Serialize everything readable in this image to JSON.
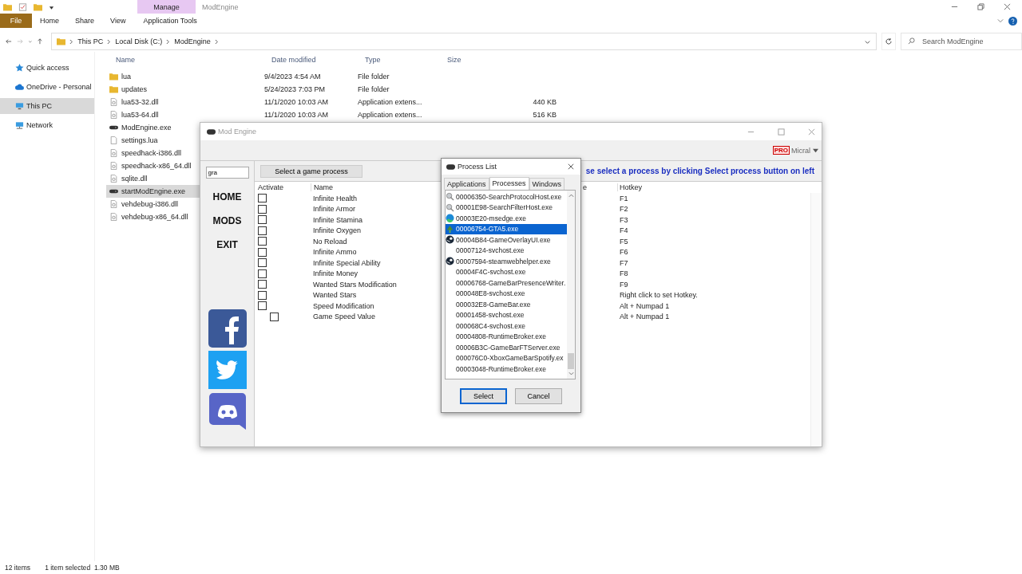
{
  "explorer": {
    "title": "ModEngine",
    "context_group": "Manage",
    "ribbon_tabs": [
      {
        "label": "File",
        "kind": "file"
      },
      {
        "label": "Home",
        "kind": "tab"
      },
      {
        "label": "Share",
        "kind": "tab"
      },
      {
        "label": "View",
        "kind": "tab"
      },
      {
        "label": "Application Tools",
        "kind": "context"
      }
    ],
    "breadcrumb": [
      "This PC",
      "Local Disk (C:)",
      "ModEngine"
    ],
    "search": {
      "placeholder": "Search ModEngine"
    },
    "nav": [
      {
        "label": "Quick access",
        "kind": "star",
        "selected": false
      },
      {
        "label": "OneDrive - Personal",
        "kind": "cloud",
        "selected": false
      },
      {
        "label": "This PC",
        "kind": "pc",
        "selected": true
      },
      {
        "label": "Network",
        "kind": "network",
        "selected": false
      }
    ],
    "columns": [
      "Name",
      "Date modified",
      "Type",
      "Size"
    ],
    "files": [
      {
        "name": "lua",
        "kind": "folder",
        "date": "9/4/2023 4:54 AM",
        "type": "File folder",
        "selected": false
      },
      {
        "name": "updates",
        "kind": "folder",
        "date": "5/24/2023 7:03 PM",
        "type": "File folder",
        "selected": false
      },
      {
        "name": "lua53-32.dll",
        "kind": "dll",
        "date": "11/1/2020 10:03 AM",
        "type": "Application extens...",
        "size": "440 KB",
        "selected": false
      },
      {
        "name": "lua53-64.dll",
        "kind": "dll",
        "date": "11/1/2020 10:03 AM",
        "type": "Application extens...",
        "size": "516 KB",
        "selected": false
      },
      {
        "name": "ModEngine.exe",
        "kind": "exe",
        "selected": false
      },
      {
        "name": "settings.lua",
        "kind": "file",
        "selected": false
      },
      {
        "name": "speedhack-i386.dll",
        "kind": "dll",
        "selected": false
      },
      {
        "name": "speedhack-x86_64.dll",
        "kind": "dll",
        "selected": false
      },
      {
        "name": "sqlite.dll",
        "kind": "dll",
        "selected": false
      },
      {
        "name": "startModEngine.exe",
        "kind": "exe",
        "selected": true
      },
      {
        "name": "vehdebug-i386.dll",
        "kind": "dll",
        "selected": false
      },
      {
        "name": "vehdebug-x86_64.dll",
        "kind": "dll",
        "selected": false
      }
    ],
    "status": {
      "count": "12 items",
      "selection": "1 item selected  1.30 MB"
    }
  },
  "mod_engine": {
    "title": "Mod Engine",
    "badge": "PRO",
    "account": "Micral",
    "search_value": "gra",
    "nav": [
      "HOME",
      "MODS",
      "EXIT"
    ],
    "select_button": "Select a game process",
    "message": "se select a process by clicking Select process button on left",
    "columns": [
      "Activate",
      "Name",
      "e",
      "Hotkey"
    ],
    "mods": [
      {
        "name": "Infinite Health",
        "hotkey": "F1",
        "checked": false
      },
      {
        "name": "Infinite Armor",
        "hotkey": "F2",
        "checked": false
      },
      {
        "name": "Infinite Stamina",
        "hotkey": "F3",
        "checked": false
      },
      {
        "name": "Infinite Oxygen",
        "hotkey": "F4",
        "checked": false
      },
      {
        "name": "No Reload",
        "hotkey": "F5",
        "checked": false
      },
      {
        "name": "Infinite Ammo",
        "hotkey": "F6",
        "checked": false
      },
      {
        "name": "Infinite Special Ability",
        "hotkey": "F7",
        "checked": false
      },
      {
        "name": "Infinite Money",
        "hotkey": "F8",
        "checked": false
      },
      {
        "name": "Wanted Stars Modification",
        "hotkey": "F9",
        "checked": false
      },
      {
        "name": "Wanted Stars",
        "hotkey": "Right click to set Hotkey.",
        "checked": false
      },
      {
        "name": "Speed Modification",
        "hotkey": "Alt + Numpad 1",
        "checked": false,
        "children": [
          {
            "name": "Game Speed Value",
            "hotkey": "Alt + Numpad 1",
            "checked": false
          }
        ]
      }
    ],
    "social": [
      {
        "kind": "facebook"
      },
      {
        "kind": "twitter"
      },
      {
        "kind": "discord"
      }
    ]
  },
  "process_list": {
    "title": "Process List",
    "tabs": [
      {
        "label": "Applications",
        "selected": false
      },
      {
        "label": "Processes",
        "selected": true
      },
      {
        "label": "Windows",
        "selected": false
      }
    ],
    "processes": [
      {
        "name": "00006350-SearchProtocolHost.exe",
        "kind": "search",
        "selected": false
      },
      {
        "name": "00001E98-SearchFilterHost.exe",
        "kind": "search",
        "selected": false
      },
      {
        "name": "00003E20-msedge.exe",
        "kind": "edge",
        "selected": false
      },
      {
        "name": "00006754-GTA5.exe",
        "kind": "tree",
        "selected": true
      },
      {
        "name": "00004B84-GameOverlayUI.exe",
        "kind": "steam",
        "selected": false
      },
      {
        "name": "00007124-svchost.exe",
        "selected": false
      },
      {
        "name": "00007594-steamwebhelper.exe",
        "kind": "steam",
        "selected": false
      },
      {
        "name": "00004F4C-svchost.exe",
        "selected": false
      },
      {
        "name": "00006768-GameBarPresenceWriter.",
        "selected": false
      },
      {
        "name": "000048E8-svchost.exe",
        "selected": false
      },
      {
        "name": "000032E8-GameBar.exe",
        "selected": false
      },
      {
        "name": "00001458-svchost.exe",
        "selected": false
      },
      {
        "name": "000068C4-svchost.exe",
        "selected": false
      },
      {
        "name": "00004808-RuntimeBroker.exe",
        "selected": false
      },
      {
        "name": "00006B3C-GameBarFTServer.exe",
        "selected": false
      },
      {
        "name": "000076C0-XboxGameBarSpotify.ex",
        "selected": false
      },
      {
        "name": "00003048-RuntimeBroker.exe",
        "selected": false
      }
    ],
    "buttons": [
      "Select",
      "Cancel"
    ]
  }
}
